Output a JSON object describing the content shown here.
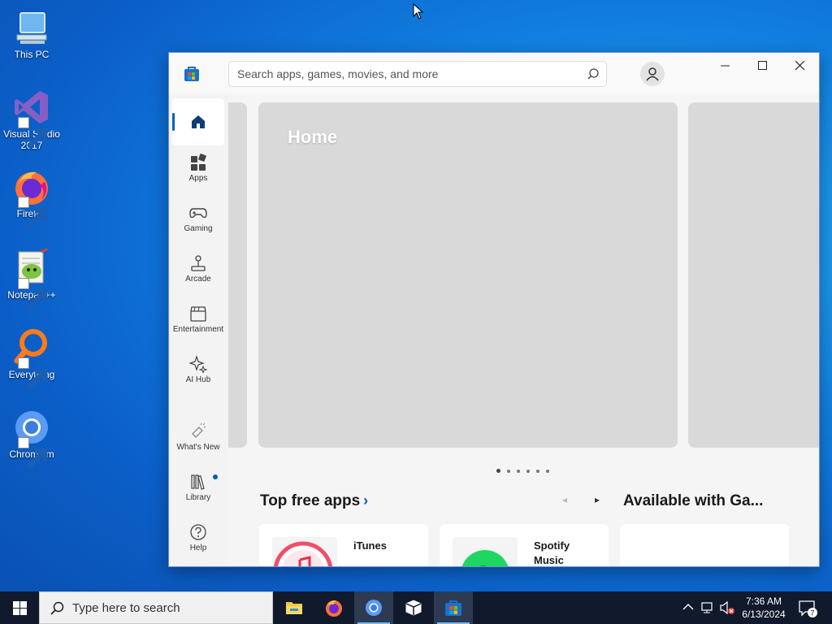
{
  "desktop": {
    "icons": [
      {
        "label": "This PC",
        "icon": "this-pc-icon"
      },
      {
        "label": "Visual Studio 2017",
        "icon": "visual-studio-icon"
      },
      {
        "label": "Firefox",
        "icon": "firefox-icon"
      },
      {
        "label": "Notepad++",
        "icon": "notepad-plus-plus-icon"
      },
      {
        "label": "Everything",
        "icon": "everything-icon"
      },
      {
        "label": "Chromium",
        "icon": "chromium-icon"
      }
    ]
  },
  "store": {
    "search_placeholder": "Search apps, games, movies, and more",
    "nav": [
      {
        "label": "",
        "icon": "home-icon",
        "active": true
      },
      {
        "label": "Apps",
        "icon": "apps-icon"
      },
      {
        "label": "Gaming",
        "icon": "gamepad-icon"
      },
      {
        "label": "Arcade",
        "icon": "joystick-icon"
      },
      {
        "label": "Entertainment",
        "icon": "clapperboard-icon"
      },
      {
        "label": "AI Hub",
        "icon": "sparkle-icon"
      },
      {
        "label": "What's New",
        "icon": "megaphone-icon"
      },
      {
        "label": "Library",
        "icon": "library-icon",
        "badge": true
      },
      {
        "label": "Help",
        "icon": "help-icon"
      }
    ],
    "hero": {
      "title": "Home",
      "dots_count": 6,
      "active_dot": 0
    },
    "sections": {
      "top_free_title": "Top free apps",
      "available_title": "Available with Ga..."
    },
    "apps": [
      {
        "name": "iTunes",
        "icon": "itunes-icon"
      },
      {
        "name": "Spotify Music",
        "icon": "spotify-icon"
      }
    ],
    "colors": {
      "accent": "#005fb8",
      "hero_placeholder": "#d9d9d9"
    }
  },
  "taskbar": {
    "search_placeholder": "Type here to search",
    "apps": [
      "file-explorer-icon",
      "firefox-icon",
      "chromium-icon",
      "package-icon",
      "microsoft-store-icon"
    ],
    "clock": {
      "time": "7:36 AM",
      "date": "6/13/2024"
    },
    "notification_count": "7"
  }
}
